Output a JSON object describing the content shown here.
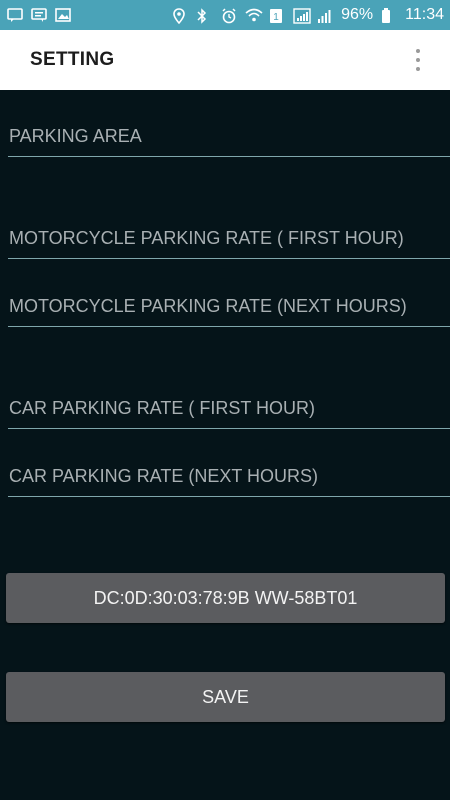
{
  "status_bar": {
    "battery": "96%",
    "time": "11:34",
    "left_icons": [
      "chat-icon",
      "message-icon",
      "image-icon"
    ],
    "right_icons": [
      "location-icon",
      "bluetooth-icon",
      "alarm-icon",
      "wifi-icon",
      "sim-icon",
      "signal-icon",
      "signal-icon",
      "battery-icon"
    ],
    "color": "#4aa3b8"
  },
  "app_bar": {
    "title": "SETTING"
  },
  "form": {
    "parking_area": {
      "placeholder": "PARKING AREA"
    },
    "moto_first": {
      "placeholder": "MOTORCYCLE PARKING RATE ( FIRST HOUR)"
    },
    "moto_next": {
      "placeholder": "MOTORCYCLE PARKING RATE (NEXT HOURS)"
    },
    "car_first": {
      "placeholder": "CAR PARKING RATE ( FIRST HOUR)"
    },
    "car_next": {
      "placeholder": "CAR PARKING RATE (NEXT HOURS)"
    }
  },
  "device_button": {
    "label": "DC:0D:30:03:78:9B WW-58BT01"
  },
  "save_button": {
    "label": "SAVE"
  },
  "colors": {
    "background": "#051419",
    "button": "#5b5c5f",
    "underline": "#7fa6ab"
  }
}
